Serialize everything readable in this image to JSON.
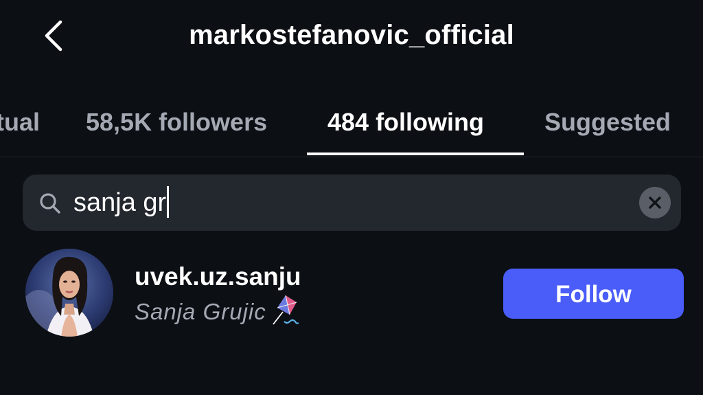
{
  "header": {
    "title": "markostefanovic_official",
    "back_icon": "chevron-left-icon"
  },
  "tabs": [
    {
      "label": "tual",
      "active": false
    },
    {
      "label": "58,5K followers",
      "active": false
    },
    {
      "label": "484 following",
      "active": true
    },
    {
      "label": "Suggested",
      "active": false
    }
  ],
  "search": {
    "value": "sanja gr",
    "icon": "search-icon",
    "clear_icon": "close-icon"
  },
  "results": [
    {
      "username": "uvek.uz.sanju",
      "full_name": "Sanja Grujic",
      "emoji": "kite-icon",
      "action_label": "Follow"
    }
  ],
  "colors": {
    "background": "#0c0f14",
    "search_bg": "#23272e",
    "accent": "#4a5df9",
    "muted_text": "#a4a9b3"
  }
}
